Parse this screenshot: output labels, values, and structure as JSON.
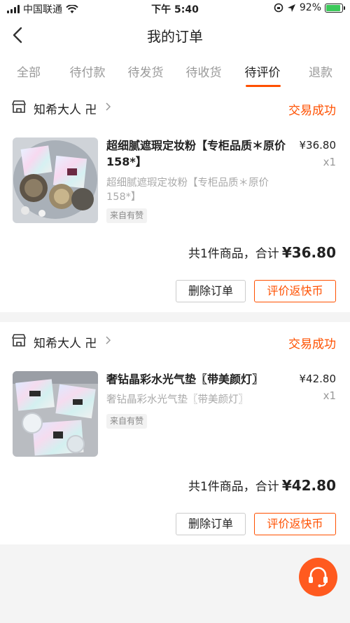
{
  "status_bar": {
    "carrier": "中国联通",
    "time": "下午 5:40",
    "battery": "92%",
    "battery_level": 0.92
  },
  "nav": {
    "title": "我的订单"
  },
  "tabs": [
    {
      "label": "全部"
    },
    {
      "label": "待付款"
    },
    {
      "label": "待发货"
    },
    {
      "label": "待收货"
    },
    {
      "label": "待评价"
    },
    {
      "label": "退款"
    }
  ],
  "active_tab": "待评价",
  "orders": [
    {
      "shop_name": "知希大人 卍",
      "status": "交易成功",
      "product_title": "超细腻遮瑕定妆粉【专柜品质＊原价158*】",
      "product_subtitle": "超细腻遮瑕定妆粉【专柜品质＊原价158*】",
      "source_tag": "来自有赞",
      "price": "¥36.80",
      "quantity": "x1",
      "summary_label": "共1件商品，合计",
      "total": "¥36.80",
      "delete_label": "删除订单",
      "review_label": "评价返快币"
    },
    {
      "shop_name": "知希大人 卍",
      "status": "交易成功",
      "product_title": "奢钻晶彩水光气垫〖带美颜灯〗",
      "product_subtitle": "奢钻晶彩水光气垫〖带美颜灯〗",
      "source_tag": "来自有赞",
      "price": "¥42.80",
      "quantity": "x1",
      "summary_label": "共1件商品，合计",
      "total": "¥42.80",
      "delete_label": "删除订单",
      "review_label": "评价返快币"
    }
  ],
  "colors": {
    "accent": "#ff5000",
    "muted": "#999999",
    "background": "#f4f4f4"
  },
  "icons": [
    "signal-icon",
    "wifi-icon",
    "location-icon",
    "battery-icon",
    "back-arrow-icon",
    "shop-icon",
    "chevron-right-icon",
    "customer-service-icon"
  ]
}
